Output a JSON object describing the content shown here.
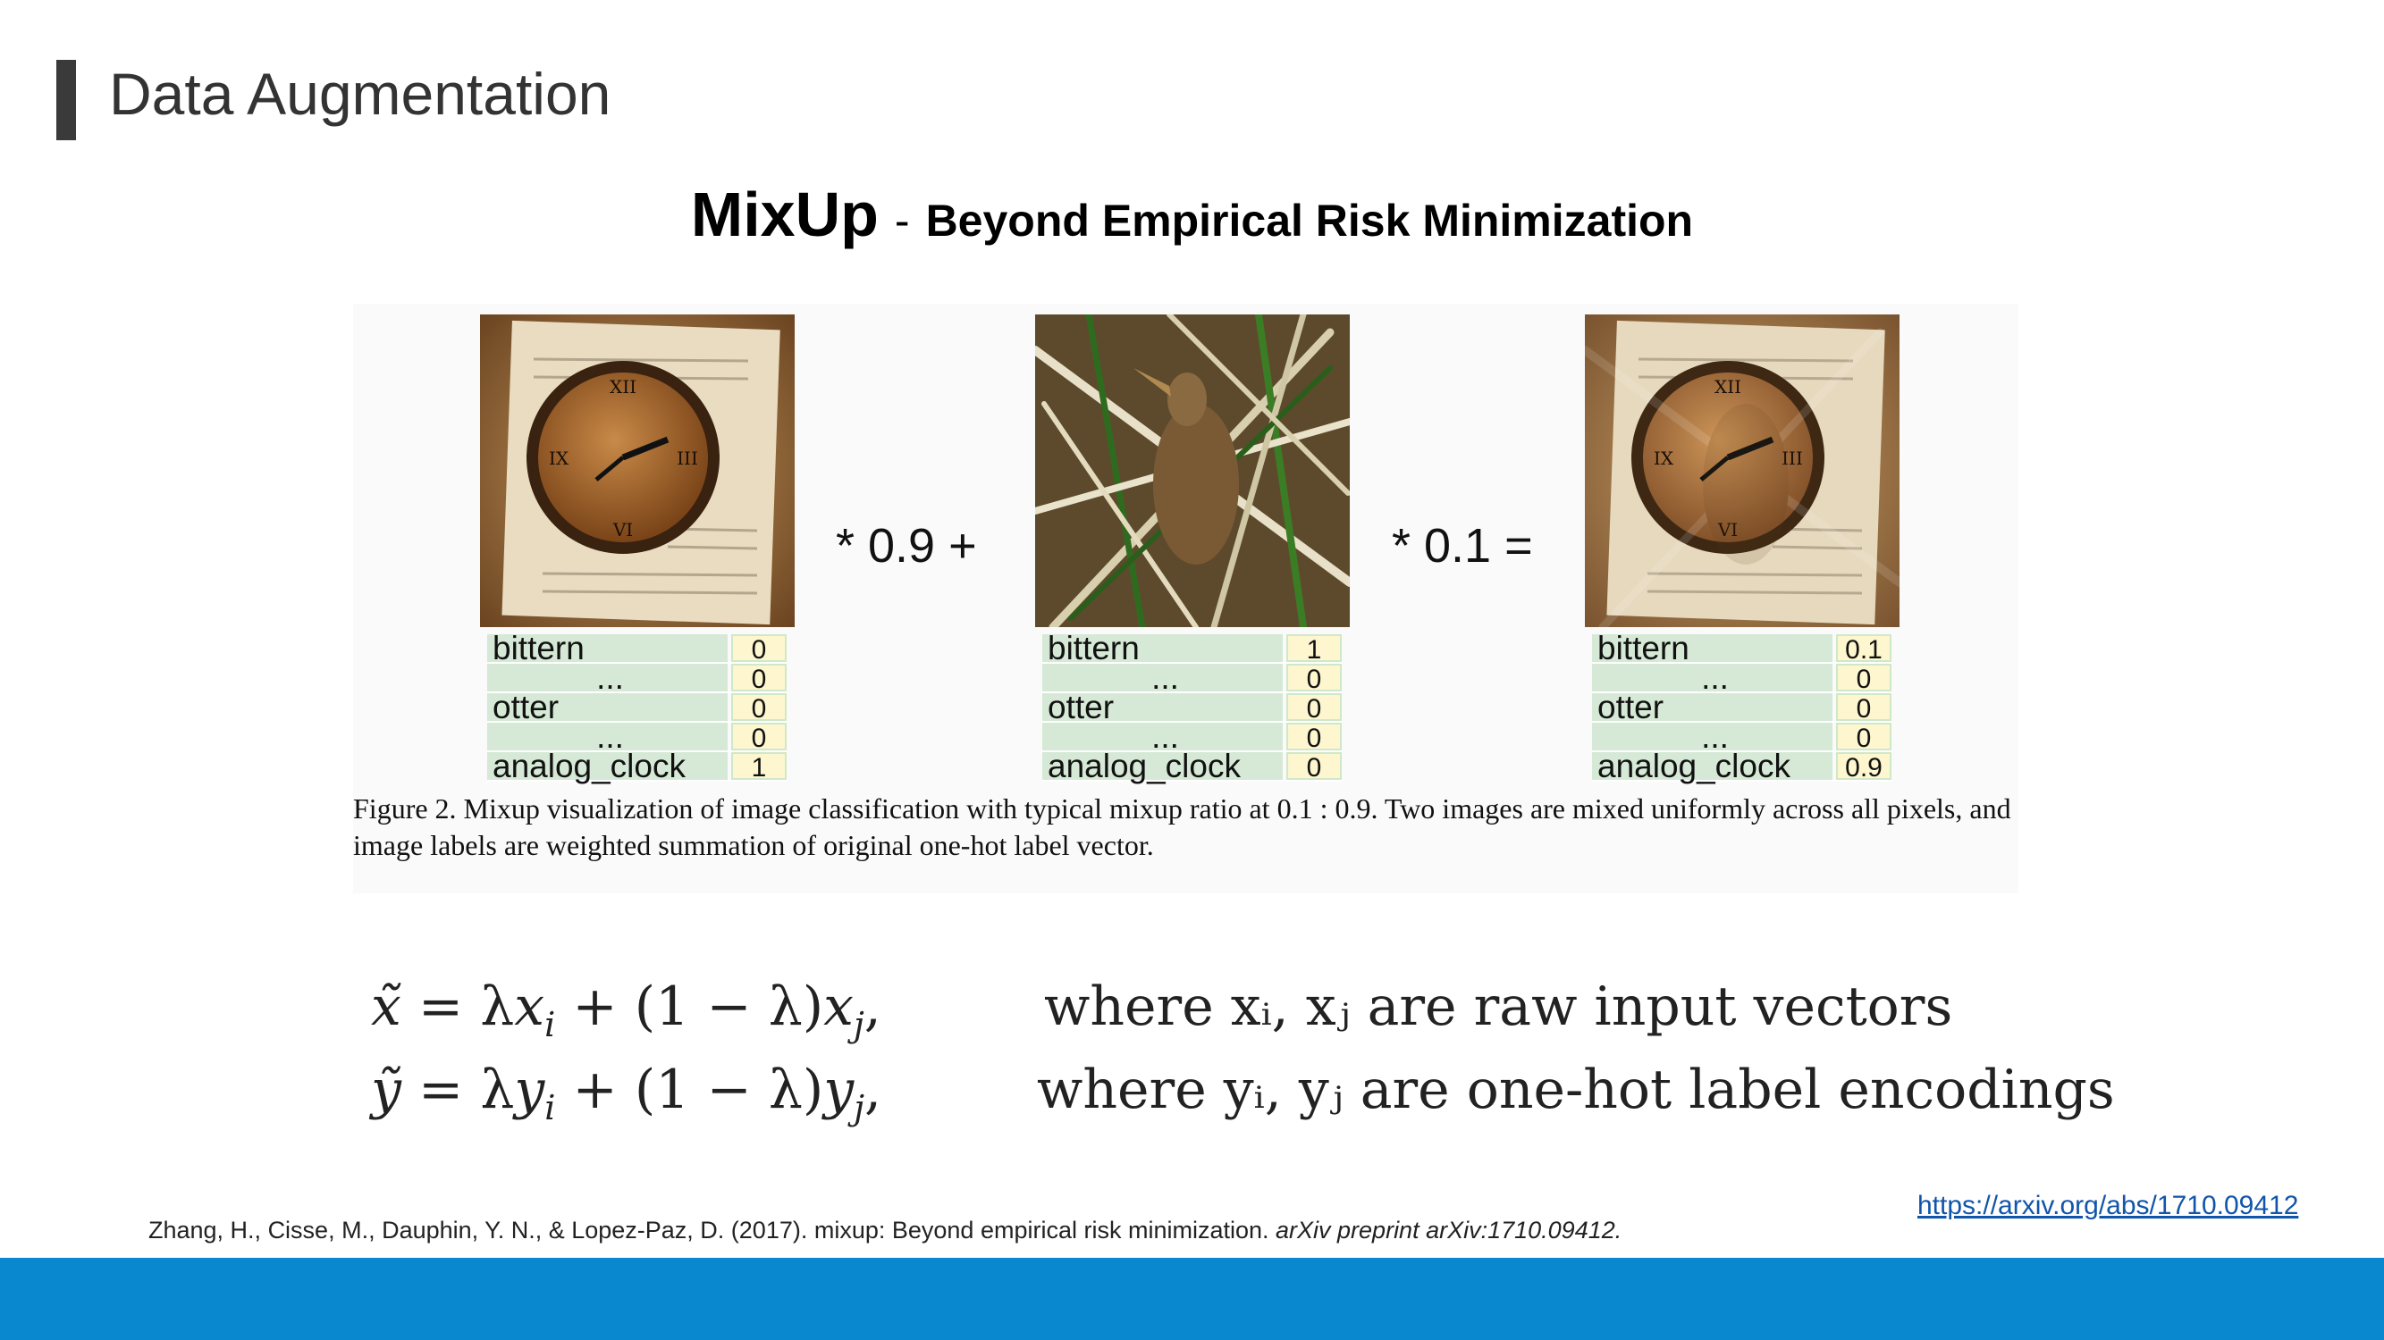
{
  "slide": {
    "title": "Data Augmentation",
    "subtitle_main": "MixUp",
    "subtitle_dash": "-",
    "subtitle_rest": "Beyond Empirical Risk Minimization"
  },
  "figure": {
    "operator_1": "* 0.9 +",
    "operator_2": "* 0.1 =",
    "tables": [
      {
        "rows": [
          {
            "name": "bittern",
            "value": "0"
          },
          {
            "name": "...",
            "value": "0"
          },
          {
            "name": "otter",
            "value": "0"
          },
          {
            "name": "...",
            "value": "0"
          },
          {
            "name": "analog_clock",
            "value": "1"
          }
        ]
      },
      {
        "rows": [
          {
            "name": "bittern",
            "value": "1"
          },
          {
            "name": "...",
            "value": "0"
          },
          {
            "name": "otter",
            "value": "0"
          },
          {
            "name": "...",
            "value": "0"
          },
          {
            "name": "analog_clock",
            "value": "0"
          }
        ]
      },
      {
        "rows": [
          {
            "name": "bittern",
            "value": "0.1"
          },
          {
            "name": "...",
            "value": "0"
          },
          {
            "name": "otter",
            "value": "0"
          },
          {
            "name": "...",
            "value": "0"
          },
          {
            "name": "analog_clock",
            "value": "0.9"
          }
        ]
      }
    ],
    "caption": "Figure 2. Mixup visualization of image classification with typical mixup ratio at 0.1 : 0.9. Two images are mixed uniformly across all pixels, and image labels are weighted summation of original one-hot label vector."
  },
  "equations": {
    "eq1_where": "where xᵢ, xⱼ are raw input vectors",
    "eq2_where": "where yᵢ, yⱼ are one-hot label encodings"
  },
  "reference": {
    "text": "Zhang, H., Cisse, M., Dauphin, Y. N., & Lopez-Paz, D. (2017). mixup: Beyond empirical risk minimization. ",
    "italic": "arXiv preprint arXiv:1710.09412."
  },
  "link": "https://arxiv.org/abs/1710.09412",
  "colors": {
    "footer": "#0a88cf",
    "title_bar": "#3a3a3a",
    "link": "#1155aa"
  }
}
